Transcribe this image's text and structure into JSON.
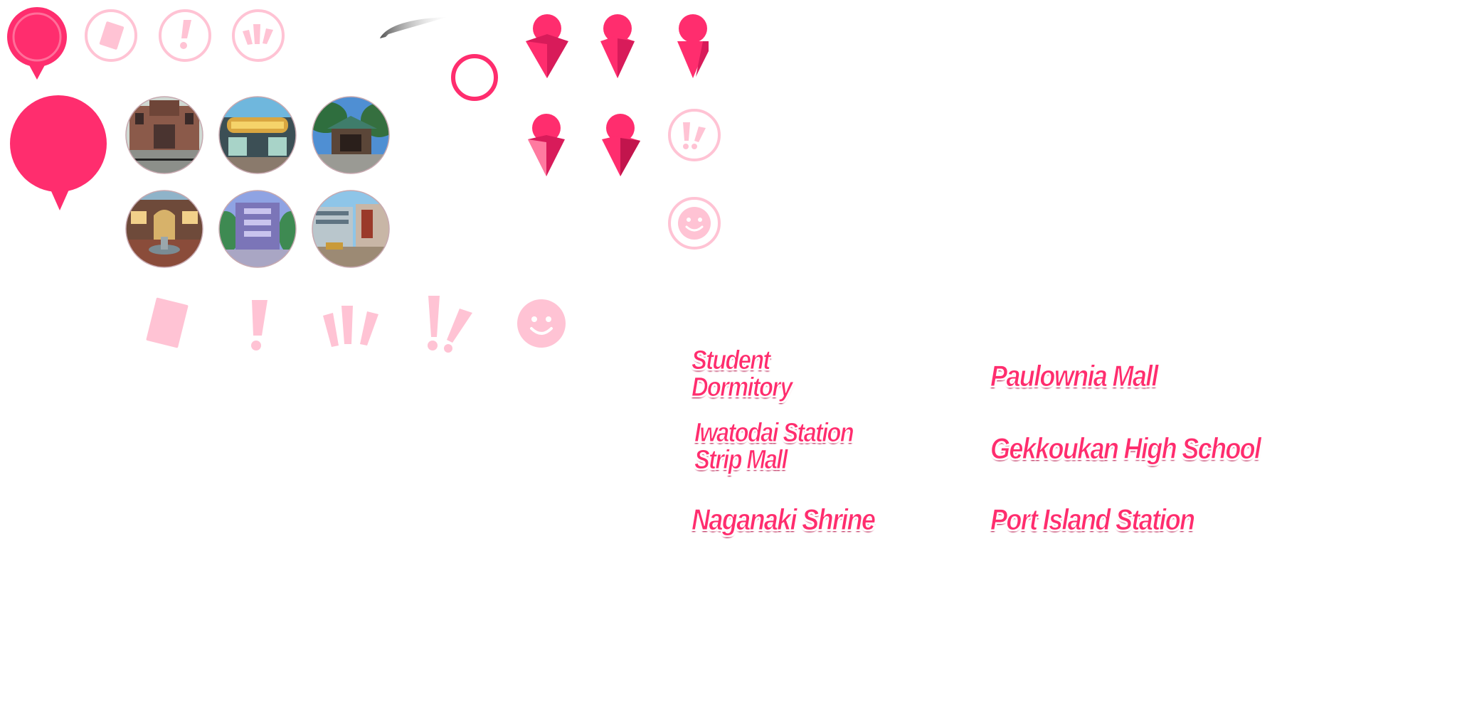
{
  "colors": {
    "accent": "#ff2d6e",
    "accent_dark": "#d81b5a",
    "accent_light": "#ffc3d4",
    "shadow": "#b0003a"
  },
  "icons": {
    "small_row": [
      "map-pin-icon",
      "card-ring-icon",
      "exclaim-ring-icon",
      "triple-exclaim-ring-icon"
    ],
    "large_row": [
      "card-icon",
      "exclaim-icon",
      "triple-exclaim-icon",
      "double-exclaim-icon",
      "smiley-icon"
    ]
  },
  "locations": {
    "thumbnails": [
      "student-dormitory-thumb",
      "iwatodai-strip-mall-thumb",
      "naganaki-shrine-thumb",
      "paulownia-mall-thumb",
      "gekkoukan-high-thumb",
      "port-island-station-thumb"
    ],
    "labels": {
      "student_dormitory": {
        "line1": "Student",
        "line2": "Dormitory"
      },
      "iwatodai_strip_mall": {
        "line1": "Iwatodai Station",
        "line2": "Strip Mall"
      },
      "naganaki_shrine": "Naganaki Shrine",
      "paulownia_mall": "Paulownia Mall",
      "gekkoukan_high": "Gekkoukan High School",
      "port_island_station": "Port Island Station"
    }
  }
}
